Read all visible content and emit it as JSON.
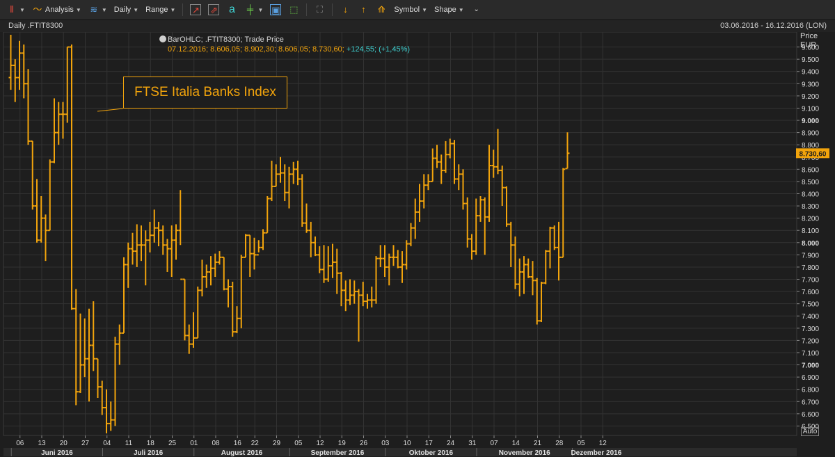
{
  "toolbar": {
    "analysis": "Analysis",
    "interval": "Daily",
    "range": "Range",
    "symbol": "Symbol",
    "shape": "Shape"
  },
  "header": {
    "title": "Daily .FTIT8300",
    "date_range": "03.06.2016 - 16.12.2016 (LON)"
  },
  "info": {
    "line1": "BarOHLC; .FTIT8300; Trade Price",
    "line2": "07.12.2016; 8.606,05; 8.902,30; 8.606,05; 8.730,60;",
    "change": "+124,55; (+1,45%)"
  },
  "annotation": "FTSE Italia Banks Index",
  "axis": {
    "price_label": "Price",
    "currency": "EUR",
    "auto": "Auto"
  },
  "colors": {
    "series": "#f2a40c",
    "background": "#1e1e1e",
    "change": "#3fd0d0"
  },
  "chart_data": {
    "type": "ohlc",
    "series_name": ".FTIT8300",
    "last_value_label": "8.730,60",
    "ylim": [
      6400,
      9700
    ],
    "y_ticks": [
      {
        "v": 9600,
        "label": "9.600",
        "bold": false
      },
      {
        "v": 9500,
        "label": "9.500",
        "bold": false
      },
      {
        "v": 9400,
        "label": "9.400",
        "bold": false
      },
      {
        "v": 9300,
        "label": "9.300",
        "bold": false
      },
      {
        "v": 9200,
        "label": "9.200",
        "bold": false
      },
      {
        "v": 9100,
        "label": "9.100",
        "bold": false
      },
      {
        "v": 9000,
        "label": "9.000",
        "bold": true
      },
      {
        "v": 8900,
        "label": "8.900",
        "bold": false
      },
      {
        "v": 8800,
        "label": "8.800",
        "bold": false
      },
      {
        "v": 8700,
        "label": "8.700",
        "bold": false
      },
      {
        "v": 8600,
        "label": "8.600",
        "bold": false
      },
      {
        "v": 8500,
        "label": "8.500",
        "bold": false
      },
      {
        "v": 8400,
        "label": "8.400",
        "bold": false
      },
      {
        "v": 8300,
        "label": "8.300",
        "bold": false
      },
      {
        "v": 8200,
        "label": "8.200",
        "bold": false
      },
      {
        "v": 8100,
        "label": "8.100",
        "bold": false
      },
      {
        "v": 8000,
        "label": "8.000",
        "bold": true
      },
      {
        "v": 7900,
        "label": "7.900",
        "bold": false
      },
      {
        "v": 7800,
        "label": "7.800",
        "bold": false
      },
      {
        "v": 7700,
        "label": "7.700",
        "bold": false
      },
      {
        "v": 7600,
        "label": "7.600",
        "bold": false
      },
      {
        "v": 7500,
        "label": "7.500",
        "bold": false
      },
      {
        "v": 7400,
        "label": "7.400",
        "bold": false
      },
      {
        "v": 7300,
        "label": "7.300",
        "bold": false
      },
      {
        "v": 7200,
        "label": "7.200",
        "bold": false
      },
      {
        "v": 7100,
        "label": "7.100",
        "bold": false
      },
      {
        "v": 7000,
        "label": "7.000",
        "bold": true
      },
      {
        "v": 6900,
        "label": "6.900",
        "bold": false
      },
      {
        "v": 6800,
        "label": "6.800",
        "bold": false
      },
      {
        "v": 6700,
        "label": "6.700",
        "bold": false
      },
      {
        "v": 6600,
        "label": "6.600",
        "bold": false
      },
      {
        "v": 6500,
        "label": "6.500",
        "bold": false
      }
    ],
    "x_ticks": [
      {
        "i": 1,
        "label": "06"
      },
      {
        "i": 6,
        "label": "13"
      },
      {
        "i": 11,
        "label": "20"
      },
      {
        "i": 16,
        "label": "27"
      },
      {
        "i": 21,
        "label": "04"
      },
      {
        "i": 26,
        "label": "11"
      },
      {
        "i": 31,
        "label": "18"
      },
      {
        "i": 36,
        "label": "25"
      },
      {
        "i": 41,
        "label": "01"
      },
      {
        "i": 46,
        "label": "08"
      },
      {
        "i": 51,
        "label": "16"
      },
      {
        "i": 55,
        "label": "22"
      },
      {
        "i": 60,
        "label": "29"
      },
      {
        "i": 65,
        "label": "05"
      },
      {
        "i": 70,
        "label": "12"
      },
      {
        "i": 75,
        "label": "19"
      },
      {
        "i": 80,
        "label": "26"
      },
      {
        "i": 85,
        "label": "03"
      },
      {
        "i": 90,
        "label": "10"
      },
      {
        "i": 95,
        "label": "17"
      },
      {
        "i": 100,
        "label": "24"
      },
      {
        "i": 105,
        "label": "31"
      },
      {
        "i": 110,
        "label": "07"
      },
      {
        "i": 115,
        "label": "14"
      },
      {
        "i": 120,
        "label": "21"
      },
      {
        "i": 125,
        "label": "28"
      },
      {
        "i": 130,
        "label": "05"
      },
      {
        "i": 135,
        "label": "12"
      }
    ],
    "months": [
      {
        "start": -1,
        "end": 20,
        "label": "Juni 2016"
      },
      {
        "start": 20,
        "end": 41,
        "label": "Juli 2016"
      },
      {
        "start": 41,
        "end": 63,
        "label": "August 2016"
      },
      {
        "start": 63,
        "end": 85,
        "label": "September 2016"
      },
      {
        "start": 85,
        "end": 106,
        "label": "Oktober 2016"
      },
      {
        "start": 106,
        "end": 128,
        "label": "November 2016"
      },
      {
        "start": 128,
        "end": 139,
        "label": "Dezember 2016"
      }
    ],
    "bars": [
      {
        "o": 9350,
        "h": 9700,
        "l": 9250,
        "c": 9450
      },
      {
        "o": 9450,
        "h": 9500,
        "l": 9150,
        "c": 9350
      },
      {
        "o": 9350,
        "h": 9650,
        "l": 9250,
        "c": 9550
      },
      {
        "o": 9550,
        "h": 9620,
        "l": 9180,
        "c": 9300
      },
      {
        "o": 9300,
        "h": 9420,
        "l": 8800,
        "c": 8830
      },
      {
        "o": 8830,
        "h": 8830,
        "l": 8270,
        "c": 8300
      },
      {
        "o": 8300,
        "h": 8520,
        "l": 8000,
        "c": 8020
      },
      {
        "o": 8020,
        "h": 8380,
        "l": 8000,
        "c": 8200
      },
      {
        "o": 8200,
        "h": 8230,
        "l": 7850,
        "c": 8100
      },
      {
        "o": 8100,
        "h": 8680,
        "l": 8100,
        "c": 8660
      },
      {
        "o": 8660,
        "h": 9180,
        "l": 8650,
        "c": 8900
      },
      {
        "o": 8900,
        "h": 9150,
        "l": 8800,
        "c": 9050
      },
      {
        "o": 9050,
        "h": 9150,
        "l": 8850,
        "c": 9050
      },
      {
        "o": 9050,
        "h": 9600,
        "l": 8980,
        "c": 9600
      },
      {
        "o": 9600,
        "h": 9620,
        "l": 7450,
        "c": 7460
      },
      {
        "o": 7460,
        "h": 7620,
        "l": 6670,
        "c": 6780
      },
      {
        "o": 6780,
        "h": 7420,
        "l": 6770,
        "c": 7000
      },
      {
        "o": 7000,
        "h": 7380,
        "l": 6900,
        "c": 7050
      },
      {
        "o": 7050,
        "h": 7460,
        "l": 6700,
        "c": 7160
      },
      {
        "o": 7160,
        "h": 7520,
        "l": 6950,
        "c": 7050
      },
      {
        "o": 7050,
        "h": 7050,
        "l": 6730,
        "c": 6820
      },
      {
        "o": 6820,
        "h": 6870,
        "l": 6590,
        "c": 6650
      },
      {
        "o": 6650,
        "h": 6800,
        "l": 6440,
        "c": 6520
      },
      {
        "o": 6520,
        "h": 6700,
        "l": 6460,
        "c": 6550
      },
      {
        "o": 6550,
        "h": 7230,
        "l": 6500,
        "c": 7170
      },
      {
        "o": 7170,
        "h": 7330,
        "l": 7000,
        "c": 7260
      },
      {
        "o": 7260,
        "h": 7880,
        "l": 7260,
        "c": 7820
      },
      {
        "o": 7820,
        "h": 8000,
        "l": 7630,
        "c": 7950
      },
      {
        "o": 7950,
        "h": 8080,
        "l": 7820,
        "c": 7930
      },
      {
        "o": 7930,
        "h": 8150,
        "l": 7800,
        "c": 7980
      },
      {
        "o": 7980,
        "h": 8140,
        "l": 7850,
        "c": 7980
      },
      {
        "o": 7980,
        "h": 8100,
        "l": 7650,
        "c": 8020
      },
      {
        "o": 8020,
        "h": 8170,
        "l": 7920,
        "c": 8060
      },
      {
        "o": 8060,
        "h": 8270,
        "l": 8000,
        "c": 8120
      },
      {
        "o": 8120,
        "h": 8170,
        "l": 7970,
        "c": 8100
      },
      {
        "o": 8100,
        "h": 8140,
        "l": 7900,
        "c": 7980
      },
      {
        "o": 7980,
        "h": 8030,
        "l": 7760,
        "c": 7950
      },
      {
        "o": 7950,
        "h": 8140,
        "l": 7720,
        "c": 8020
      },
      {
        "o": 8020,
        "h": 8150,
        "l": 7860,
        "c": 8100
      },
      {
        "o": 8100,
        "h": 8430,
        "l": 7980,
        "c": 7700
      },
      {
        "o": 7700,
        "h": 7700,
        "l": 7200,
        "c": 7240
      },
      {
        "o": 7240,
        "h": 7330,
        "l": 7090,
        "c": 7170
      },
      {
        "o": 7170,
        "h": 7430,
        "l": 7140,
        "c": 7220
      },
      {
        "o": 7220,
        "h": 7640,
        "l": 7220,
        "c": 7610
      },
      {
        "o": 7610,
        "h": 7860,
        "l": 7560,
        "c": 7720
      },
      {
        "o": 7720,
        "h": 7820,
        "l": 7630,
        "c": 7760
      },
      {
        "o": 7760,
        "h": 7890,
        "l": 7650,
        "c": 7790
      },
      {
        "o": 7790,
        "h": 7910,
        "l": 7720,
        "c": 7840
      },
      {
        "o": 7840,
        "h": 7930,
        "l": 7820,
        "c": 7880
      },
      {
        "o": 7880,
        "h": 7880,
        "l": 7610,
        "c": 7620
      },
      {
        "o": 7620,
        "h": 7700,
        "l": 7470,
        "c": 7640
      },
      {
        "o": 7640,
        "h": 7680,
        "l": 7230,
        "c": 7270
      },
      {
        "o": 7270,
        "h": 7480,
        "l": 7260,
        "c": 7380
      },
      {
        "o": 7380,
        "h": 7900,
        "l": 7300,
        "c": 7880
      },
      {
        "o": 7880,
        "h": 8070,
        "l": 7880,
        "c": 8060
      },
      {
        "o": 8060,
        "h": 8060,
        "l": 7720,
        "c": 7910
      },
      {
        "o": 7910,
        "h": 8040,
        "l": 7780,
        "c": 7900
      },
      {
        "o": 7900,
        "h": 8020,
        "l": 7920,
        "c": 7960
      },
      {
        "o": 7960,
        "h": 8110,
        "l": 7940,
        "c": 8080
      },
      {
        "o": 8080,
        "h": 8380,
        "l": 8080,
        "c": 8360
      },
      {
        "o": 8360,
        "h": 8670,
        "l": 8340,
        "c": 8460
      },
      {
        "o": 8460,
        "h": 8640,
        "l": 8460,
        "c": 8560
      },
      {
        "o": 8560,
        "h": 8700,
        "l": 8490,
        "c": 8570
      },
      {
        "o": 8570,
        "h": 8640,
        "l": 8340,
        "c": 8410
      },
      {
        "o": 8410,
        "h": 8620,
        "l": 8280,
        "c": 8560
      },
      {
        "o": 8560,
        "h": 8660,
        "l": 8480,
        "c": 8600
      },
      {
        "o": 8600,
        "h": 8670,
        "l": 8470,
        "c": 8520
      },
      {
        "o": 8520,
        "h": 8560,
        "l": 8130,
        "c": 8160
      },
      {
        "o": 8160,
        "h": 8320,
        "l": 8080,
        "c": 8100
      },
      {
        "o": 8100,
        "h": 8170,
        "l": 7880,
        "c": 8000
      },
      {
        "o": 8000,
        "h": 8050,
        "l": 7890,
        "c": 7900
      },
      {
        "o": 7900,
        "h": 7970,
        "l": 7750,
        "c": 7780
      },
      {
        "o": 7780,
        "h": 7980,
        "l": 7670,
        "c": 7700
      },
      {
        "o": 7700,
        "h": 7970,
        "l": 7680,
        "c": 7810
      },
      {
        "o": 7810,
        "h": 7990,
        "l": 7710,
        "c": 7840
      },
      {
        "o": 7840,
        "h": 7950,
        "l": 7580,
        "c": 7750
      },
      {
        "o": 7750,
        "h": 7760,
        "l": 7480,
        "c": 7610
      },
      {
        "o": 7610,
        "h": 7690,
        "l": 7440,
        "c": 7530
      },
      {
        "o": 7530,
        "h": 7700,
        "l": 7490,
        "c": 7570
      },
      {
        "o": 7570,
        "h": 7690,
        "l": 7500,
        "c": 7600
      },
      {
        "o": 7600,
        "h": 7620,
        "l": 7190,
        "c": 7570
      },
      {
        "o": 7570,
        "h": 7680,
        "l": 7480,
        "c": 7520
      },
      {
        "o": 7520,
        "h": 7580,
        "l": 7460,
        "c": 7530
      },
      {
        "o": 7530,
        "h": 7640,
        "l": 7470,
        "c": 7530
      },
      {
        "o": 7530,
        "h": 7890,
        "l": 7500,
        "c": 7870
      },
      {
        "o": 7870,
        "h": 7980,
        "l": 7800,
        "c": 7870
      },
      {
        "o": 7870,
        "h": 7980,
        "l": 7720,
        "c": 7800
      },
      {
        "o": 7800,
        "h": 7910,
        "l": 7650,
        "c": 7880
      },
      {
        "o": 7880,
        "h": 7980,
        "l": 7810,
        "c": 7880
      },
      {
        "o": 7880,
        "h": 7940,
        "l": 7790,
        "c": 7800
      },
      {
        "o": 7800,
        "h": 7930,
        "l": 7670,
        "c": 7820
      },
      {
        "o": 7820,
        "h": 8020,
        "l": 7780,
        "c": 7990
      },
      {
        "o": 7990,
        "h": 8160,
        "l": 7970,
        "c": 8120
      },
      {
        "o": 8120,
        "h": 8360,
        "l": 8030,
        "c": 8250
      },
      {
        "o": 8250,
        "h": 8480,
        "l": 8170,
        "c": 8340
      },
      {
        "o": 8340,
        "h": 8560,
        "l": 8280,
        "c": 8470
      },
      {
        "o": 8470,
        "h": 8560,
        "l": 8430,
        "c": 8500
      },
      {
        "o": 8500,
        "h": 8770,
        "l": 8500,
        "c": 8690
      },
      {
        "o": 8690,
        "h": 8800,
        "l": 8610,
        "c": 8660
      },
      {
        "o": 8660,
        "h": 8720,
        "l": 8480,
        "c": 8590
      },
      {
        "o": 8590,
        "h": 8830,
        "l": 8570,
        "c": 8720
      },
      {
        "o": 8720,
        "h": 8850,
        "l": 8690,
        "c": 8810
      },
      {
        "o": 8810,
        "h": 8840,
        "l": 8480,
        "c": 8520
      },
      {
        "o": 8520,
        "h": 8640,
        "l": 8430,
        "c": 8560
      },
      {
        "o": 8560,
        "h": 8600,
        "l": 8270,
        "c": 8320
      },
      {
        "o": 8320,
        "h": 8370,
        "l": 7960,
        "c": 8030
      },
      {
        "o": 8030,
        "h": 8070,
        "l": 7860,
        "c": 7930
      },
      {
        "o": 7930,
        "h": 8360,
        "l": 7900,
        "c": 8220
      },
      {
        "o": 8220,
        "h": 8380,
        "l": 8170,
        "c": 8350
      },
      {
        "o": 8350,
        "h": 8370,
        "l": 7900,
        "c": 8210
      },
      {
        "o": 8210,
        "h": 8800,
        "l": 8170,
        "c": 8630
      },
      {
        "o": 8630,
        "h": 8760,
        "l": 8530,
        "c": 8620
      },
      {
        "o": 8620,
        "h": 8930,
        "l": 8560,
        "c": 8590
      },
      {
        "o": 8590,
        "h": 8630,
        "l": 8300,
        "c": 8450
      },
      {
        "o": 8450,
        "h": 8460,
        "l": 8130,
        "c": 8150
      },
      {
        "o": 8150,
        "h": 8170,
        "l": 7800,
        "c": 7980
      },
      {
        "o": 7980,
        "h": 8050,
        "l": 7620,
        "c": 7660
      },
      {
        "o": 7660,
        "h": 7870,
        "l": 7560,
        "c": 7760
      },
      {
        "o": 7760,
        "h": 7890,
        "l": 7580,
        "c": 7820
      },
      {
        "o": 7820,
        "h": 7870,
        "l": 7710,
        "c": 7720
      },
      {
        "o": 7720,
        "h": 7850,
        "l": 7570,
        "c": 7690
      },
      {
        "o": 7690,
        "h": 7710,
        "l": 7330,
        "c": 7360
      },
      {
        "o": 7360,
        "h": 7680,
        "l": 7350,
        "c": 7670
      },
      {
        "o": 7670,
        "h": 7940,
        "l": 7660,
        "c": 7930
      },
      {
        "o": 7930,
        "h": 8130,
        "l": 7790,
        "c": 8120
      },
      {
        "o": 8120,
        "h": 8140,
        "l": 7940,
        "c": 7960
      },
      {
        "o": 7960,
        "h": 8170,
        "l": 7690,
        "c": 7880
      },
      {
        "o": 7880,
        "h": 8610,
        "l": 7880,
        "c": 8600
      },
      {
        "o": 8606,
        "h": 8902,
        "l": 8606,
        "c": 8731
      }
    ]
  }
}
